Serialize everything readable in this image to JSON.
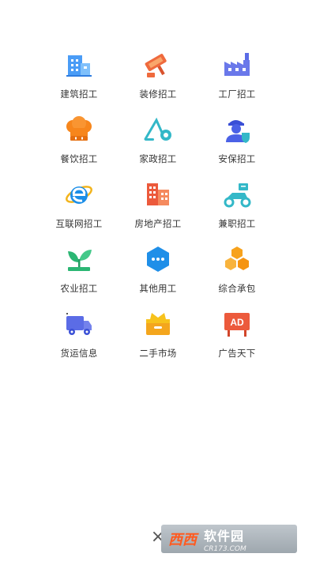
{
  "categories": [
    {
      "label": "建筑招工",
      "icon": "building-icon"
    },
    {
      "label": "装修招工",
      "icon": "paint-roller-icon"
    },
    {
      "label": "工厂招工",
      "icon": "factory-icon"
    },
    {
      "label": "餐饮招工",
      "icon": "chef-hat-icon"
    },
    {
      "label": "家政招工",
      "icon": "vacuum-cleaner-icon"
    },
    {
      "label": "安保招工",
      "icon": "security-guard-icon"
    },
    {
      "label": "互联网招工",
      "icon": "internet-explorer-icon"
    },
    {
      "label": "房地产招工",
      "icon": "buildings-icon"
    },
    {
      "label": "兼职招工",
      "icon": "scooter-icon"
    },
    {
      "label": "农业招工",
      "icon": "sprout-icon"
    },
    {
      "label": "其他用工",
      "icon": "more-hexagon-icon"
    },
    {
      "label": "综合承包",
      "icon": "honeycomb-icon"
    },
    {
      "label": "货运信息",
      "icon": "truck-icon"
    },
    {
      "label": "二手市场",
      "icon": "box-icon"
    },
    {
      "label": "广告天下",
      "icon": "ad-board-icon"
    }
  ],
  "footer": {
    "close_symbol": "×",
    "watermark_badge": "西西",
    "watermark_main": "软件园",
    "watermark_sub": "CR173.COM"
  },
  "colors": {
    "blue": "#3d8ff5",
    "orange": "#f7861c",
    "red": "#ec5a3c",
    "green": "#2bb673",
    "teal": "#33b8c8",
    "indigo": "#5b6ce6"
  }
}
